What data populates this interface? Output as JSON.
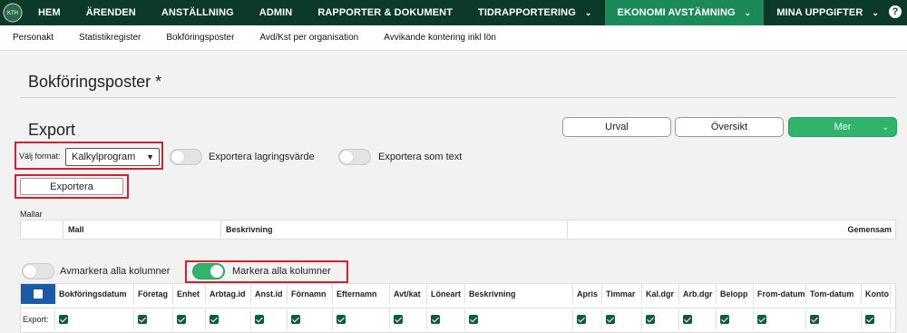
{
  "nav": {
    "items": [
      {
        "label": "HEM"
      },
      {
        "label": "ÄRENDEN"
      },
      {
        "label": "ANSTÄLLNING"
      },
      {
        "label": "ADMIN"
      },
      {
        "label": "RAPPORTER & DOKUMENT"
      },
      {
        "label": "TIDRAPPORTERING"
      },
      {
        "label": "EKONOMI AVSTÄMNING"
      },
      {
        "label": "MINA UPPGIFTER"
      }
    ],
    "help": "?"
  },
  "subnav": {
    "items": [
      {
        "label": "Personakt"
      },
      {
        "label": "Statistikregister"
      },
      {
        "label": "Bokföringsposter"
      },
      {
        "label": "Avd/Kst per organisation"
      },
      {
        "label": "Avvikande kontering inkl lön"
      }
    ]
  },
  "page": {
    "title": "Bokföringsposter *",
    "section_title": "Export"
  },
  "actions": {
    "urval": "Urval",
    "oversikt": "Översikt",
    "mer": "Mer"
  },
  "format": {
    "label": "Välj format:",
    "value": "Kalkylprogram"
  },
  "toggles": {
    "lagringsvarde": "Exportera lagringsvärde",
    "som_text": "Exportera som text",
    "avmarkera": "Avmarkera alla kolumner",
    "markera": "Markera alla kolumner"
  },
  "export_button": "Exportera",
  "mallar": {
    "label": "Mallar",
    "headers": {
      "mall": "Mall",
      "beskrivning": "Beskrivning",
      "gemensam": "Gemensam"
    }
  },
  "columns": {
    "headers": [
      "Bokföringsdatum",
      "Företag",
      "Enhet",
      "Arbtag.id",
      "Anst.id",
      "Förnamn",
      "Efternamn",
      "Avt/kat",
      "Löneart",
      "Beskrivning",
      "Apris",
      "Timmar",
      "Kal.dgr",
      "Arb.dgr",
      "Belopp",
      "From-datum",
      "Tom-datum",
      "Konto"
    ],
    "row_label": "Export:"
  },
  "colors": {
    "topnav_bg": "#0b3a2a",
    "active_nav": "#1b8a58",
    "accent_green": "#2fb36d",
    "highlight_red": "#d4202c",
    "checkbox": "#0b5e3c",
    "master_checkbox": "#1a5aa8"
  }
}
